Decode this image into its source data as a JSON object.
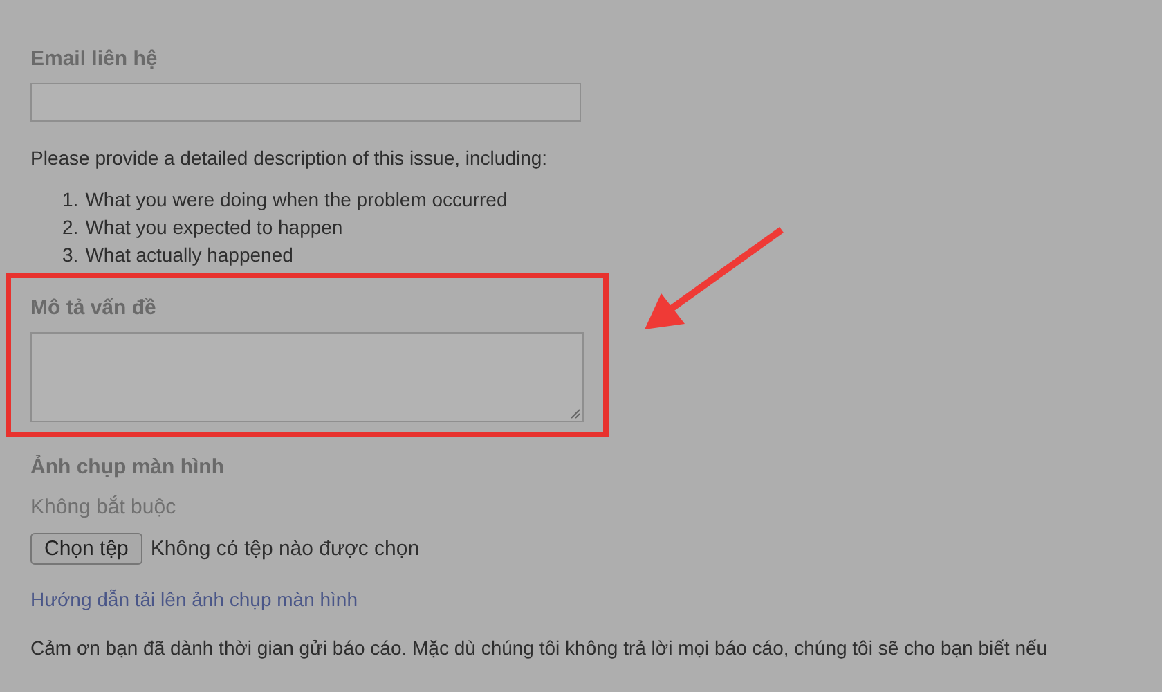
{
  "email": {
    "label": "Email liên hệ"
  },
  "instructions": {
    "intro": "Please provide a detailed description of this issue, including:",
    "items": [
      {
        "number": "1.",
        "text": "What you were doing when the problem occurred"
      },
      {
        "number": "2.",
        "text": "What you expected to happen"
      },
      {
        "number": "3.",
        "text": "What actually happened"
      }
    ]
  },
  "description": {
    "label": "Mô tả vấn đề"
  },
  "screenshot": {
    "label": "Ảnh chụp màn hình",
    "hint": "Không bắt buộc",
    "button": "Chọn tệp",
    "file_status": "Không có tệp nào được chọn",
    "help_link": "Hướng dẫn tải lên ảnh chụp màn hình"
  },
  "thanks": "Cảm ơn bạn đã dành thời gian gửi báo cáo. Mặc dù chúng tôi không trả lời mọi báo cáo, chúng tôi sẽ cho bạn biết nếu"
}
